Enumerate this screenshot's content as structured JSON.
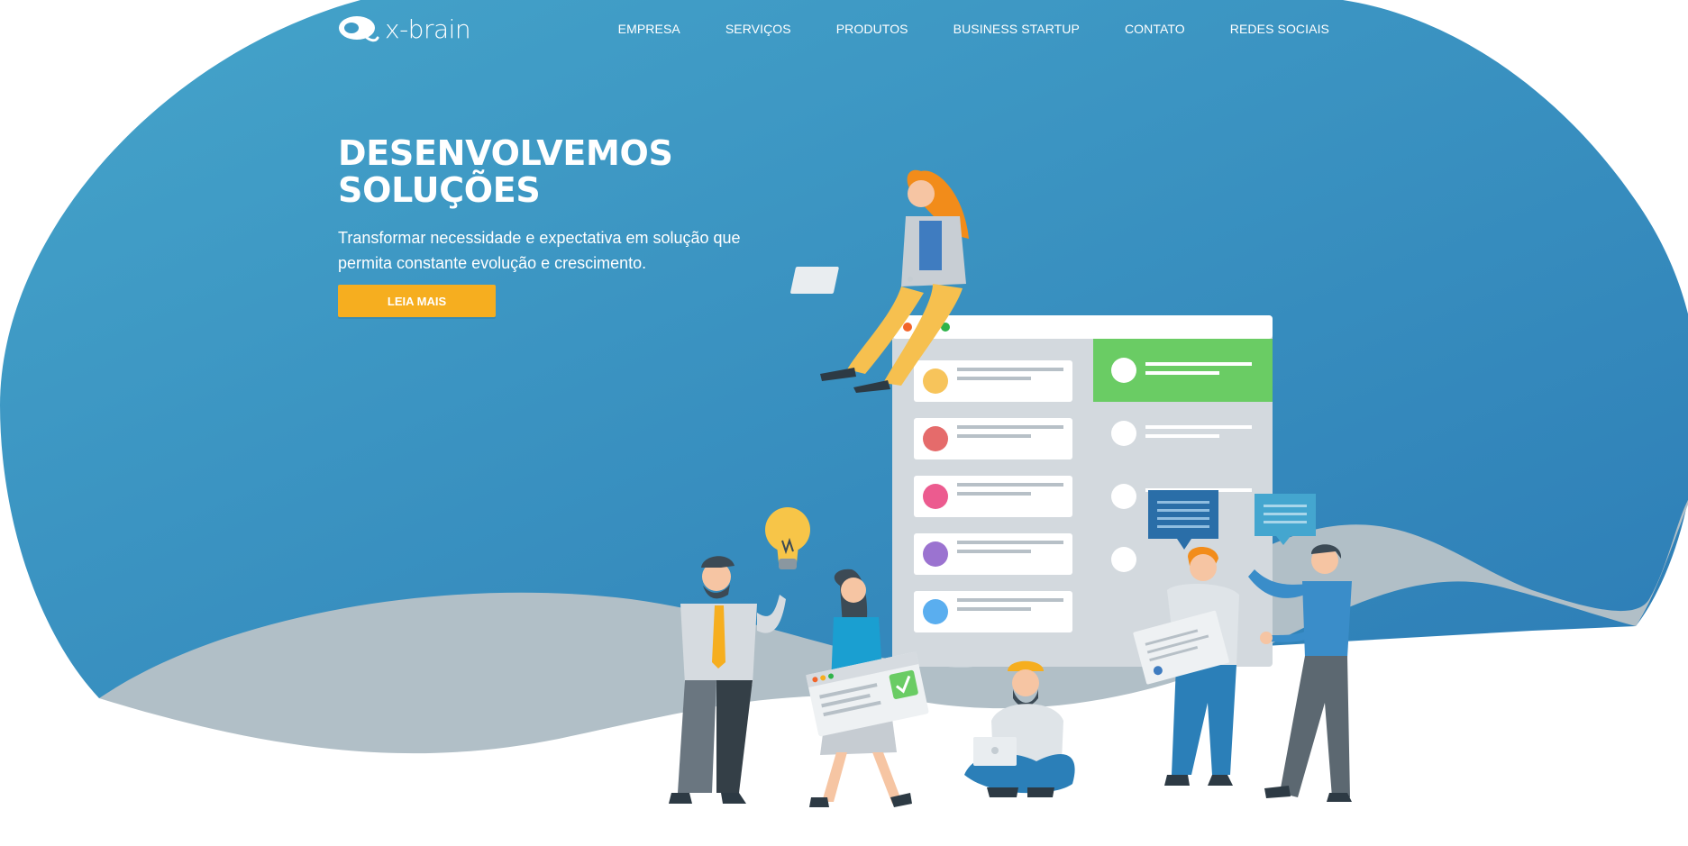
{
  "brand": {
    "name": "x-brain"
  },
  "nav": {
    "items": [
      "EMPRESA",
      "SERVIÇOS",
      "PRODUTOS",
      "BUSINESS STARTUP",
      "CONTATO",
      "REDES SOCIAIS"
    ]
  },
  "hero": {
    "title_line1": "DESENVOLVEMOS",
    "title_line2": "SOLUÇÕES",
    "subtitle": "Transformar necessidade e expectativa em solução que permita constante evolução e crescimento.",
    "cta_label": "LEIA MAIS"
  },
  "colors": {
    "hero_blue_light": "#44a1c8",
    "hero_blue_dark": "#2f7fb8",
    "wave_gray": "#b1bfc7",
    "cta_yellow": "#f6ae1f",
    "panel_green": "#6acc64"
  },
  "icons": [
    "x-brain-logo-icon",
    "lightbulb-icon",
    "check-icon",
    "chat-bubble-icon"
  ]
}
